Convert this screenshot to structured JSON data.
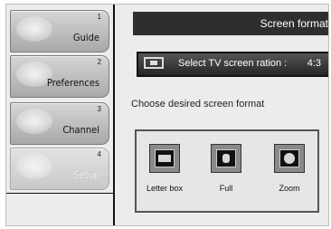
{
  "sidebar": {
    "items": [
      {
        "num": "1",
        "label": "Guide"
      },
      {
        "num": "2",
        "label": "Preferences"
      },
      {
        "num": "3",
        "label": "Channel"
      },
      {
        "num": "4",
        "label": "Setup"
      }
    ]
  },
  "header": {
    "title": "Screen format"
  },
  "ratio": {
    "label": "Select TV screen ration :",
    "value": "4:3"
  },
  "instruction": "Choose desired screen format",
  "formats": [
    {
      "label": "Letter box",
      "icon": "letterbox-icon"
    },
    {
      "label": "Full",
      "icon": "full-screen-icon"
    },
    {
      "label": "Zoom",
      "icon": "zoom-icon"
    }
  ]
}
